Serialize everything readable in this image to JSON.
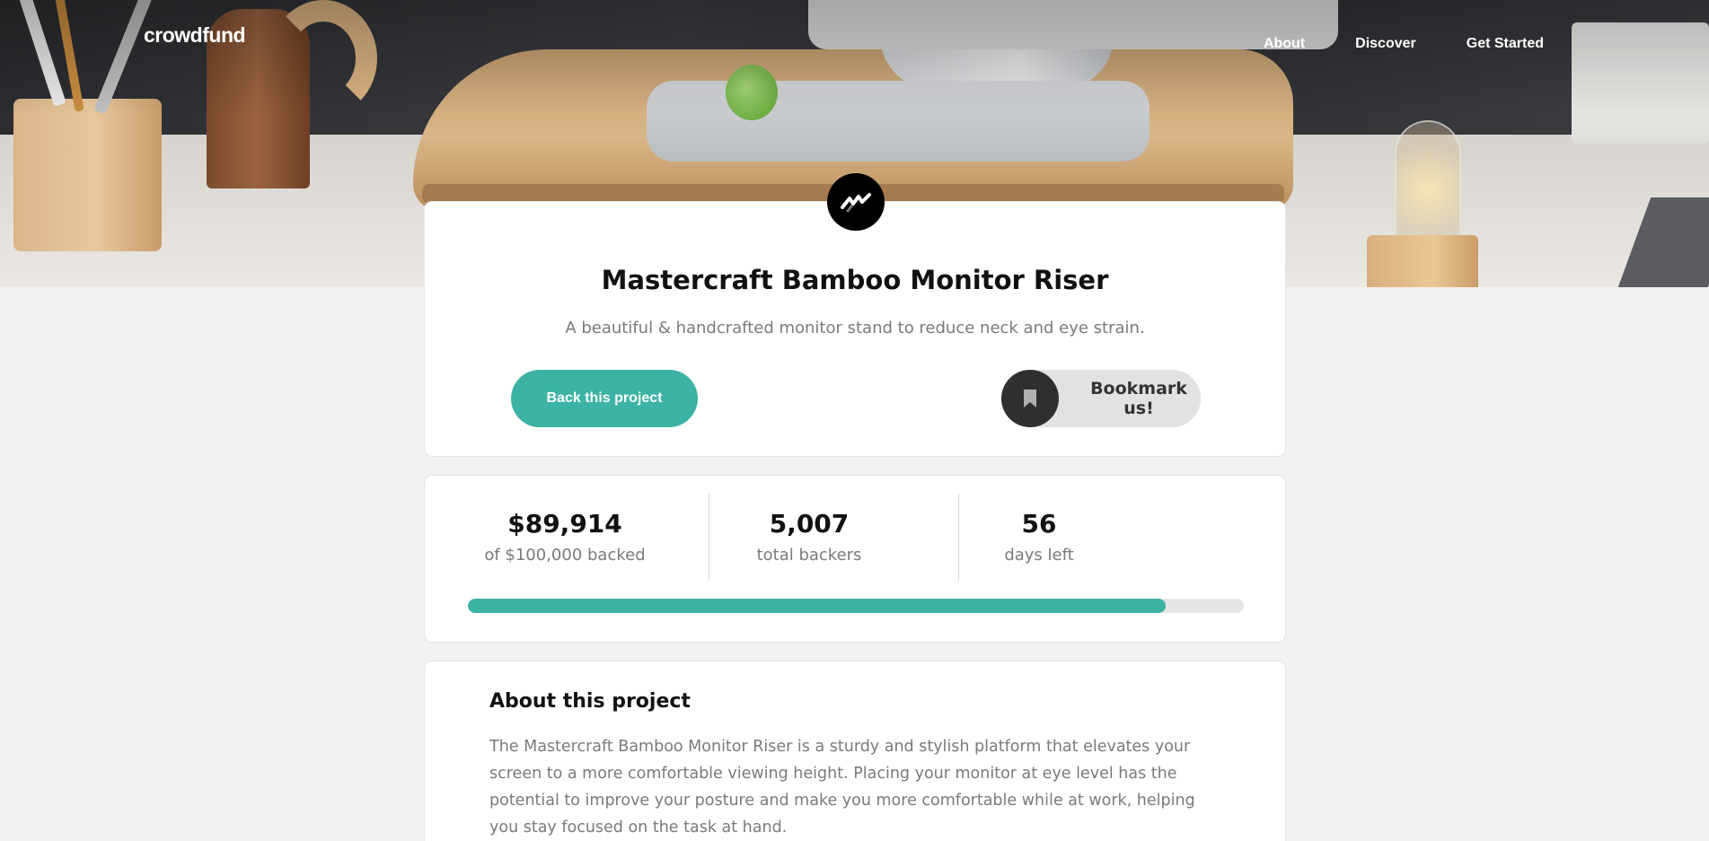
{
  "header": {
    "logo": "crowdfund",
    "nav": [
      "About",
      "Discover",
      "Get Started"
    ]
  },
  "project": {
    "title": "Mastercraft Bamboo Monitor Riser",
    "subtitle": "A beautiful & handcrafted monitor stand to reduce neck and eye strain.",
    "back_button": "Back this project",
    "bookmark_button": "Bookmark us!"
  },
  "stats": {
    "backed_amount": "$89,914",
    "backed_label": "of $100,000 backed",
    "backers_count": "5,007",
    "backers_label": "total backers",
    "days_count": "56",
    "days_label": "days left",
    "progress_fraction": 0.89914
  },
  "about": {
    "title": "About this project",
    "text": "The Mastercraft Bamboo Monitor Riser is a sturdy and stylish platform that elevates your screen to a more comfortable viewing height. Placing your monitor at eye level has the potential to improve your posture and make you more comfortable while at work, helping you stay focused on the task at hand."
  },
  "colors": {
    "accent": "#3cb3a4",
    "dark": "#2f2f2f",
    "background": "#f2f2f2"
  },
  "icons": {
    "brand": "mastercraft-logo-icon",
    "bookmark": "bookmark-icon"
  }
}
